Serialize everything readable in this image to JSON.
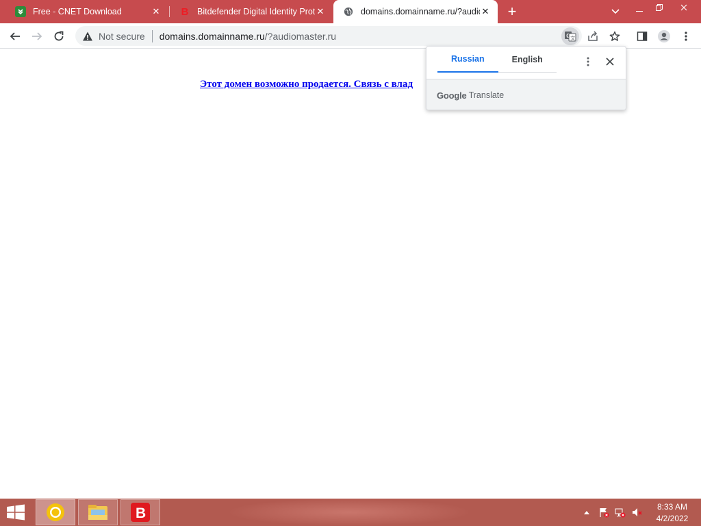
{
  "browser": {
    "tabs": [
      {
        "title": "Free - CNET Download",
        "favicon": "cnet-download-icon",
        "active": false
      },
      {
        "title": "Bitdefender Digital Identity Prote",
        "favicon": "bitdefender-icon",
        "active": false
      },
      {
        "title": "domains.domainname.ru/?audio",
        "favicon": "globe-icon",
        "active": true
      }
    ],
    "new_tab_label": "+",
    "colors": {
      "tabstrip": "#c74b4e",
      "link": "#0000ee",
      "accent": "#1a73e8"
    }
  },
  "toolbar": {
    "security_label": "Not secure",
    "url_host": "domains.domainname.ru",
    "url_rest": "/?audiomaster.ru"
  },
  "page": {
    "link_text": "Этот домен возможно продается. Связь с влад"
  },
  "translate_bubble": {
    "source_language": "Russian",
    "target_language": "English",
    "selected": "Russian",
    "brand": "Google",
    "product": "Translate"
  },
  "taskbar": {
    "apps": [
      "chrome-icon",
      "file-explorer-icon",
      "bitdefender-icon"
    ],
    "time": "8:33 AM",
    "date": "4/2/2022"
  }
}
